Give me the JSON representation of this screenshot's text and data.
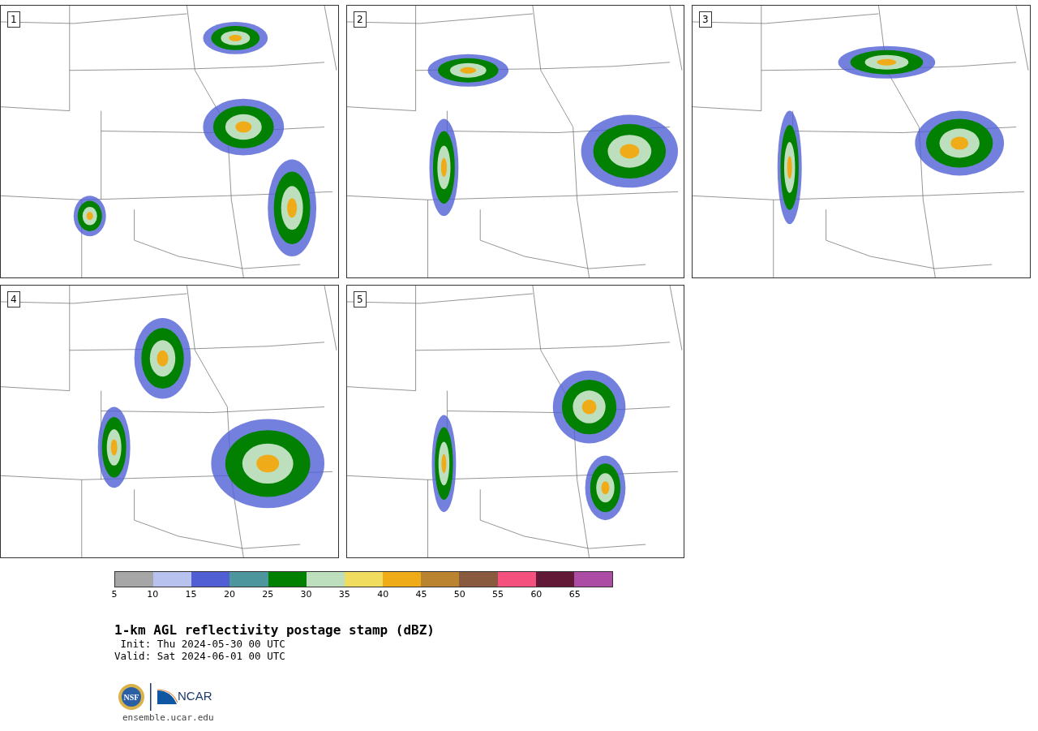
{
  "panels": [
    {
      "label": "1"
    },
    {
      "label": "2"
    },
    {
      "label": "3"
    },
    {
      "label": "4"
    },
    {
      "label": "5"
    }
  ],
  "colorbar": {
    "bins": [
      {
        "color": "#a6a6a6"
      },
      {
        "color": "#b8c2ee"
      },
      {
        "color": "#5060d4"
      },
      {
        "color": "#4e969e"
      },
      {
        "color": "#018001"
      },
      {
        "color": "#bedfbe"
      },
      {
        "color": "#f0dc5e"
      },
      {
        "color": "#f0ac18"
      },
      {
        "color": "#b98330"
      },
      {
        "color": "#8a5a3e"
      },
      {
        "color": "#f4517e"
      },
      {
        "color": "#621837"
      },
      {
        "color": "#ac4ca4"
      }
    ],
    "ticks": [
      "5",
      "10",
      "15",
      "20",
      "25",
      "30",
      "35",
      "40",
      "45",
      "50",
      "55",
      "60",
      "65"
    ]
  },
  "title": "1-km AGL reflectivity postage stamp (dBZ)",
  "init": " Init: Thu 2024-05-30 00 UTC",
  "valid": "Valid: Sat 2024-06-01 00 UTC",
  "logos": {
    "nsf": "NSF",
    "ncar": "NCAR"
  },
  "footer": "ensemble.ucar.edu"
}
